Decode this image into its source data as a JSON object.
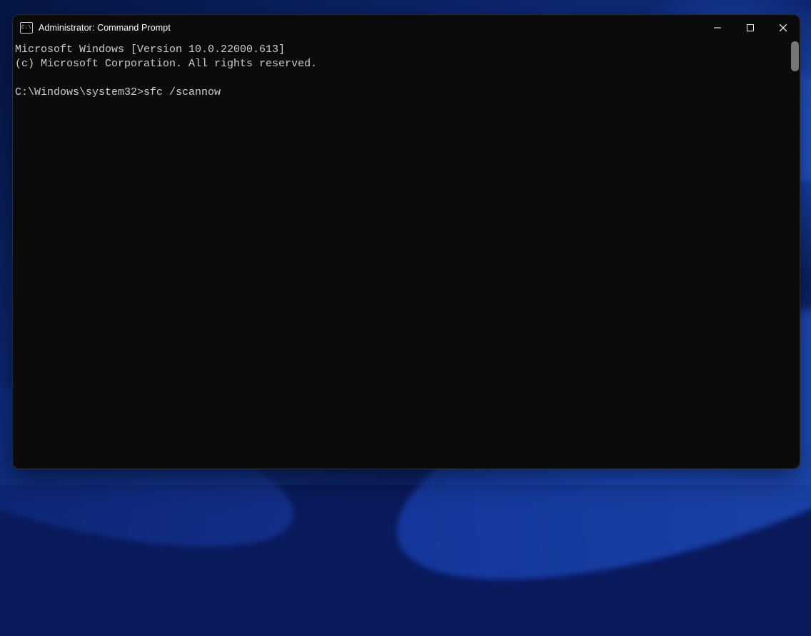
{
  "window": {
    "title": "Administrator: Command Prompt",
    "icon_label": "C:\\"
  },
  "terminal": {
    "line1": "Microsoft Windows [Version 10.0.22000.613]",
    "line2": "(c) Microsoft Corporation. All rights reserved.",
    "prompt": "C:\\Windows\\system32>",
    "command": "sfc /scannow"
  }
}
